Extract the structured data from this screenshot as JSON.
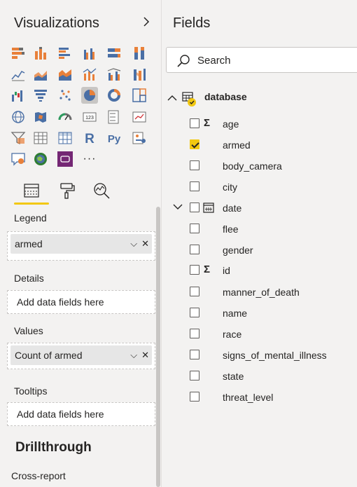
{
  "visualizations": {
    "title": "Visualizations",
    "icons": [
      [
        "stacked-bar-chart-icon",
        "stacked-column-chart-icon",
        "clustered-bar-chart-icon",
        "clustered-column-chart-icon",
        "100pct-stacked-bar-chart-icon",
        "100pct-stacked-column-chart-icon"
      ],
      [
        "line-chart-icon",
        "area-chart-icon",
        "stacked-area-chart-icon",
        "line-stacked-column-chart-icon",
        "line-clustered-column-chart-icon",
        "ribbon-chart-icon"
      ],
      [
        "waterfall-chart-icon",
        "funnel-chart-icon",
        "scatter-chart-icon",
        "pie-chart-icon",
        "donut-chart-icon",
        "treemap-icon"
      ],
      [
        "map-icon",
        "filled-map-icon",
        "gauge-icon",
        "card-icon",
        "multi-row-card-icon",
        "kpi-icon"
      ],
      [
        "slicer-icon",
        "table-icon",
        "matrix-icon",
        "r-visual-icon",
        "python-visual-icon",
        "key-influencers-icon"
      ],
      [
        "qa-icon",
        "arcgis-map-icon",
        "power-apps-icon",
        "more-visuals-icon"
      ]
    ],
    "selected_icon": "pie-chart-icon",
    "more_label": "···",
    "r_label": "R",
    "py_label": "Py",
    "card_label": "123"
  },
  "format_tabs": [
    "fields-tab",
    "format-tab",
    "analytics-tab"
  ],
  "wells": {
    "legend": {
      "label": "Legend",
      "value": "armed"
    },
    "details": {
      "label": "Details",
      "placeholder": "Add data fields here"
    },
    "values": {
      "label": "Values",
      "value": "Count of armed"
    },
    "tooltips": {
      "label": "Tooltips",
      "placeholder": "Add data fields here"
    }
  },
  "drillthrough": {
    "title": "Drillthrough",
    "cross_report": "Cross-report"
  },
  "fields": {
    "title": "Fields",
    "search_placeholder": "Search",
    "table_name": "database",
    "items": [
      {
        "name": "age",
        "checked": false,
        "type": "sigma"
      },
      {
        "name": "armed",
        "checked": true,
        "type": "none"
      },
      {
        "name": "body_camera",
        "checked": false,
        "type": "none"
      },
      {
        "name": "city",
        "checked": false,
        "type": "none"
      },
      {
        "name": "date",
        "checked": false,
        "type": "calendar"
      },
      {
        "name": "flee",
        "checked": false,
        "type": "none"
      },
      {
        "name": "gender",
        "checked": false,
        "type": "none"
      },
      {
        "name": "id",
        "checked": false,
        "type": "sigma"
      },
      {
        "name": "manner_of_death",
        "checked": false,
        "type": "none"
      },
      {
        "name": "name",
        "checked": false,
        "type": "none"
      },
      {
        "name": "race",
        "checked": false,
        "type": "none"
      },
      {
        "name": "signs_of_mental_illness",
        "checked": false,
        "type": "none"
      },
      {
        "name": "state",
        "checked": false,
        "type": "none"
      },
      {
        "name": "threat_level",
        "checked": false,
        "type": "none"
      }
    ],
    "sigma_symbol": "Σ"
  },
  "colors": {
    "accent": "#f2c811",
    "bar_orange": "#e8803a",
    "bar_blue": "#4a6fa5"
  }
}
